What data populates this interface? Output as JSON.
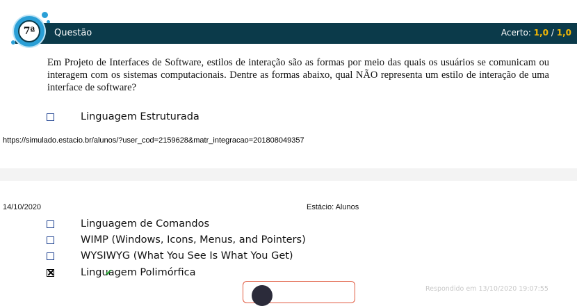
{
  "question": {
    "number_label": "7ª",
    "header_label": "Questão",
    "score_label": "Acerto:",
    "score_value": "1,0",
    "score_separator": "/",
    "score_total": "1,0",
    "text": "Em Projeto de Interfaces de Software, estilos de interação são as formas por meio das quais os usuários se comunicam ou interagem com os sistemas computacionais. Dentre as formas abaixo, qual NÃO representa um estilo de interação de uma interface de software?"
  },
  "options": [
    {
      "label": "Linguagem Estruturada",
      "checked": false
    },
    {
      "label": "Linguagem de Comandos",
      "checked": false
    },
    {
      "label": "WIMP (Windows, Icons, Menus, and Pointers)",
      "checked": false
    },
    {
      "label": "WYSIWYG (What You See Is What You Get)",
      "checked": false
    },
    {
      "label": "Linguagem Polimórfica",
      "checked": true,
      "correct": true
    }
  ],
  "print_header": {
    "url": "https://simulado.estacio.br/alunos/?user_cod=2159628&matr_integracao=201808049357",
    "date": "14/10/2020",
    "site_title": "Estácio: Alunos"
  },
  "answered_text": "Respondido em 13/10/2020 19:07:55",
  "colors": {
    "header_bg": "#0b3a4a",
    "score_accent": "#f2b705",
    "badge_blue": "#2a9fd6",
    "correct_green": "#1a9e2a"
  }
}
